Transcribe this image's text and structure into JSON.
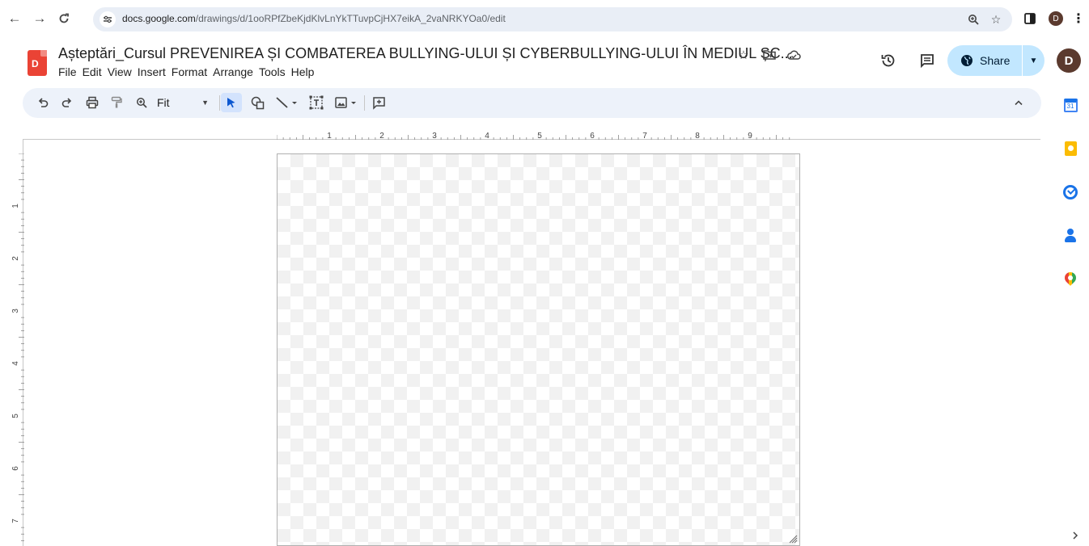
{
  "browser": {
    "url_host": "docs.google.com",
    "url_path": "/drawings/d/1ooRPfZbeKjdKlvLnYkTTuvpCjHX7eikA_2vaNRKYOa0/edit",
    "profile_initial": "D",
    "icons": [
      "back-arrow",
      "forward-arrow",
      "reload",
      "site-info",
      "zoom",
      "bookmark-star",
      "side-panel",
      "profile",
      "more-vertical"
    ]
  },
  "app": {
    "logo_text": "D",
    "title": "Așteptări_Cursul PREVENIREA ȘI COMBATEREA BULLYING-ULUI ȘI CYBERBULLYING-ULUI ÎN MEDIUL ȘC...",
    "menu": [
      "File",
      "Edit",
      "View",
      "Insert",
      "Format",
      "Arrange",
      "Tools",
      "Help"
    ],
    "share_label": "Share",
    "user_initial": "D",
    "accent_color": "#c2e7ff"
  },
  "toolbar": {
    "zoom_value": "Fit"
  },
  "rulers": {
    "horizontal": [
      "1",
      "2",
      "3",
      "4",
      "5",
      "6",
      "7",
      "8",
      "9"
    ],
    "vertical": [
      "1",
      "2",
      "3",
      "4",
      "5",
      "6",
      "7"
    ]
  },
  "side_panel": {
    "calendar_day": "31"
  }
}
